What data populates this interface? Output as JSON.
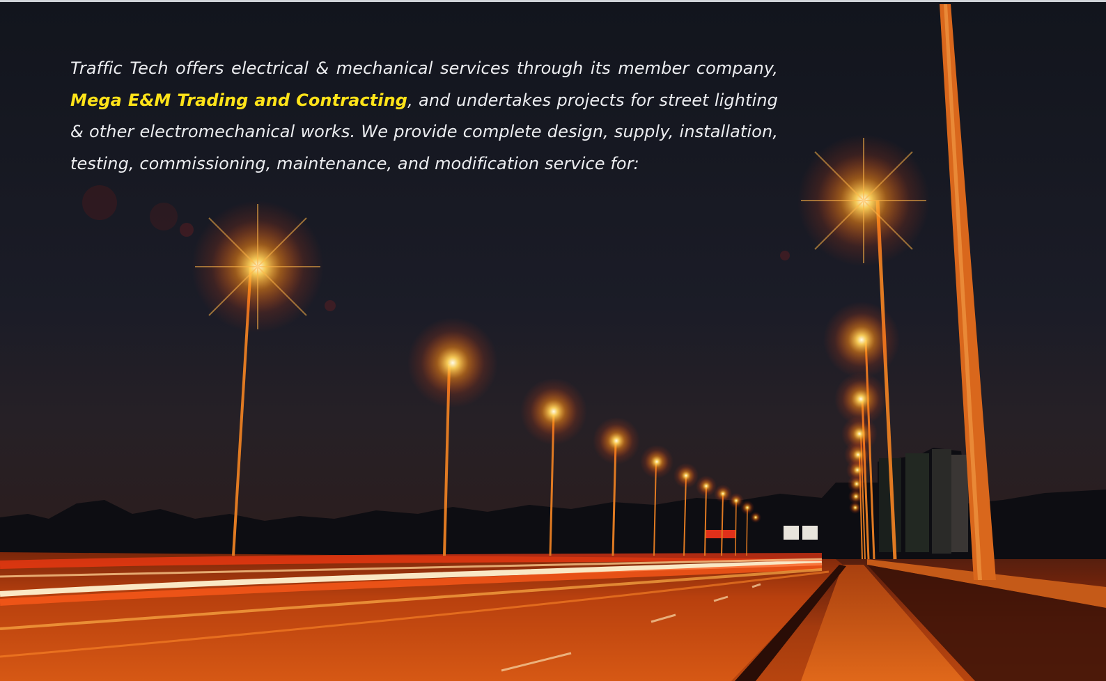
{
  "intro": {
    "text_before": "Traffic Tech offers electrical & mechanical services through its member company,",
    "company_name": "Mega E&M Trading and Contracting",
    "text_after": ", and undertakes projects for street lighting & other electromechanical works. We provide complete design, supply, installation, testing, commissioning, maintenance, and modification service for:"
  },
  "colors": {
    "highlight": "#ffe319",
    "text": "#ecedf0",
    "lamp_glow": "#ff9a1a",
    "sky": "#181b25"
  },
  "image": {
    "subject_icon": "street-lights-night-highway-photo"
  }
}
